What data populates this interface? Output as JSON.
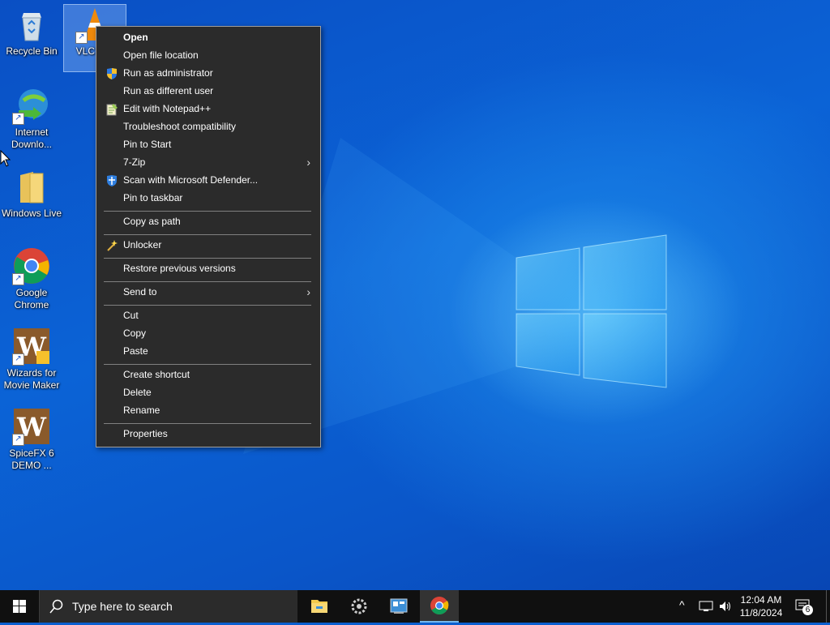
{
  "desktop": {
    "icons": [
      {
        "label": "Recycle Bin"
      },
      {
        "label": "VLC media player",
        "label_visible": "VLC m..."
      },
      {
        "label": "Internet Downlo..."
      },
      {
        "label": "Windows Live"
      },
      {
        "label": "Google Chrome"
      },
      {
        "label": "Wizards for Movie Maker"
      },
      {
        "label": "SpiceFX 6 DEMO ..."
      }
    ]
  },
  "context_menu": {
    "items": [
      {
        "label": "Open",
        "bold": true
      },
      {
        "label": "Open file location"
      },
      {
        "label": "Run as administrator",
        "icon": "uac-shield-icon"
      },
      {
        "label": "Run as different user"
      },
      {
        "label": "Edit with Notepad++",
        "icon": "notepadpp-icon"
      },
      {
        "label": "Troubleshoot compatibility"
      },
      {
        "label": "Pin to Start"
      },
      {
        "label": "7-Zip",
        "submenu": true
      },
      {
        "label": "Scan with Microsoft Defender...",
        "icon": "defender-shield-icon"
      },
      {
        "label": "Pin to taskbar"
      },
      {
        "label": "Copy as path"
      },
      {
        "label": "Unlocker",
        "icon": "unlocker-wand-icon"
      },
      {
        "label": "Restore previous versions"
      },
      {
        "label": "Send to",
        "submenu": true
      },
      {
        "label": "Cut"
      },
      {
        "label": "Copy"
      },
      {
        "label": "Paste"
      },
      {
        "label": "Create shortcut"
      },
      {
        "label": "Delete"
      },
      {
        "label": "Rename"
      },
      {
        "label": "Properties"
      }
    ],
    "submenu_arrow": "›"
  },
  "taskbar": {
    "search_placeholder": "Type here to search",
    "apps": [
      "file-explorer-icon",
      "settings-gear-icon",
      "control-panel-icon",
      "chrome-icon"
    ],
    "clock": {
      "time": "12:04 AM",
      "date": "11/8/2024"
    },
    "notification_count": "6",
    "tray_chevron": "^"
  },
  "colors": {
    "menu_bg": "#2b2b2b",
    "taskbar_bg": "#101010",
    "accent": "#76b9ed"
  }
}
